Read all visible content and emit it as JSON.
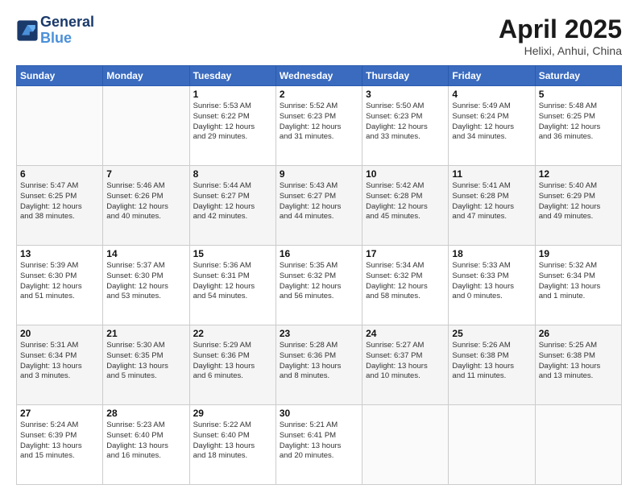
{
  "header": {
    "logo_line1": "General",
    "logo_line2": "Blue",
    "month": "April 2025",
    "location": "Helixi, Anhui, China"
  },
  "weekdays": [
    "Sunday",
    "Monday",
    "Tuesday",
    "Wednesday",
    "Thursday",
    "Friday",
    "Saturday"
  ],
  "weeks": [
    [
      {
        "day": "",
        "detail": ""
      },
      {
        "day": "",
        "detail": ""
      },
      {
        "day": "1",
        "detail": "Sunrise: 5:53 AM\nSunset: 6:22 PM\nDaylight: 12 hours\nand 29 minutes."
      },
      {
        "day": "2",
        "detail": "Sunrise: 5:52 AM\nSunset: 6:23 PM\nDaylight: 12 hours\nand 31 minutes."
      },
      {
        "day": "3",
        "detail": "Sunrise: 5:50 AM\nSunset: 6:23 PM\nDaylight: 12 hours\nand 33 minutes."
      },
      {
        "day": "4",
        "detail": "Sunrise: 5:49 AM\nSunset: 6:24 PM\nDaylight: 12 hours\nand 34 minutes."
      },
      {
        "day": "5",
        "detail": "Sunrise: 5:48 AM\nSunset: 6:25 PM\nDaylight: 12 hours\nand 36 minutes."
      }
    ],
    [
      {
        "day": "6",
        "detail": "Sunrise: 5:47 AM\nSunset: 6:25 PM\nDaylight: 12 hours\nand 38 minutes."
      },
      {
        "day": "7",
        "detail": "Sunrise: 5:46 AM\nSunset: 6:26 PM\nDaylight: 12 hours\nand 40 minutes."
      },
      {
        "day": "8",
        "detail": "Sunrise: 5:44 AM\nSunset: 6:27 PM\nDaylight: 12 hours\nand 42 minutes."
      },
      {
        "day": "9",
        "detail": "Sunrise: 5:43 AM\nSunset: 6:27 PM\nDaylight: 12 hours\nand 44 minutes."
      },
      {
        "day": "10",
        "detail": "Sunrise: 5:42 AM\nSunset: 6:28 PM\nDaylight: 12 hours\nand 45 minutes."
      },
      {
        "day": "11",
        "detail": "Sunrise: 5:41 AM\nSunset: 6:28 PM\nDaylight: 12 hours\nand 47 minutes."
      },
      {
        "day": "12",
        "detail": "Sunrise: 5:40 AM\nSunset: 6:29 PM\nDaylight: 12 hours\nand 49 minutes."
      }
    ],
    [
      {
        "day": "13",
        "detail": "Sunrise: 5:39 AM\nSunset: 6:30 PM\nDaylight: 12 hours\nand 51 minutes."
      },
      {
        "day": "14",
        "detail": "Sunrise: 5:37 AM\nSunset: 6:30 PM\nDaylight: 12 hours\nand 53 minutes."
      },
      {
        "day": "15",
        "detail": "Sunrise: 5:36 AM\nSunset: 6:31 PM\nDaylight: 12 hours\nand 54 minutes."
      },
      {
        "day": "16",
        "detail": "Sunrise: 5:35 AM\nSunset: 6:32 PM\nDaylight: 12 hours\nand 56 minutes."
      },
      {
        "day": "17",
        "detail": "Sunrise: 5:34 AM\nSunset: 6:32 PM\nDaylight: 12 hours\nand 58 minutes."
      },
      {
        "day": "18",
        "detail": "Sunrise: 5:33 AM\nSunset: 6:33 PM\nDaylight: 13 hours\nand 0 minutes."
      },
      {
        "day": "19",
        "detail": "Sunrise: 5:32 AM\nSunset: 6:34 PM\nDaylight: 13 hours\nand 1 minute."
      }
    ],
    [
      {
        "day": "20",
        "detail": "Sunrise: 5:31 AM\nSunset: 6:34 PM\nDaylight: 13 hours\nand 3 minutes."
      },
      {
        "day": "21",
        "detail": "Sunrise: 5:30 AM\nSunset: 6:35 PM\nDaylight: 13 hours\nand 5 minutes."
      },
      {
        "day": "22",
        "detail": "Sunrise: 5:29 AM\nSunset: 6:36 PM\nDaylight: 13 hours\nand 6 minutes."
      },
      {
        "day": "23",
        "detail": "Sunrise: 5:28 AM\nSunset: 6:36 PM\nDaylight: 13 hours\nand 8 minutes."
      },
      {
        "day": "24",
        "detail": "Sunrise: 5:27 AM\nSunset: 6:37 PM\nDaylight: 13 hours\nand 10 minutes."
      },
      {
        "day": "25",
        "detail": "Sunrise: 5:26 AM\nSunset: 6:38 PM\nDaylight: 13 hours\nand 11 minutes."
      },
      {
        "day": "26",
        "detail": "Sunrise: 5:25 AM\nSunset: 6:38 PM\nDaylight: 13 hours\nand 13 minutes."
      }
    ],
    [
      {
        "day": "27",
        "detail": "Sunrise: 5:24 AM\nSunset: 6:39 PM\nDaylight: 13 hours\nand 15 minutes."
      },
      {
        "day": "28",
        "detail": "Sunrise: 5:23 AM\nSunset: 6:40 PM\nDaylight: 13 hours\nand 16 minutes."
      },
      {
        "day": "29",
        "detail": "Sunrise: 5:22 AM\nSunset: 6:40 PM\nDaylight: 13 hours\nand 18 minutes."
      },
      {
        "day": "30",
        "detail": "Sunrise: 5:21 AM\nSunset: 6:41 PM\nDaylight: 13 hours\nand 20 minutes."
      },
      {
        "day": "",
        "detail": ""
      },
      {
        "day": "",
        "detail": ""
      },
      {
        "day": "",
        "detail": ""
      }
    ]
  ]
}
